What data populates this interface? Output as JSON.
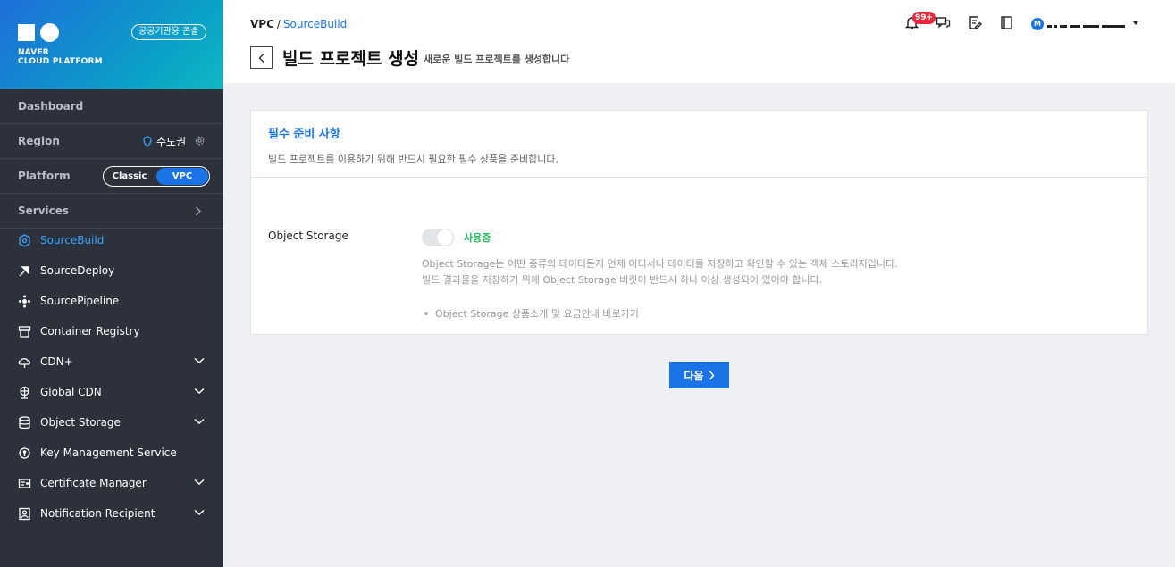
{
  "brand": {
    "line1": "NAVER",
    "line2": "CLOUD PLATFORM",
    "badge": "공공기관용 콘솔"
  },
  "sidebar": {
    "dashboard": "Dashboard",
    "region_label": "Region",
    "region_value": "수도권",
    "platform_label": "Platform",
    "platform_options": [
      "Classic",
      "VPC"
    ],
    "platform_selected": "VPC",
    "services_label": "Services",
    "items": [
      {
        "label": "SourceBuild",
        "icon": "sourcebuild-icon",
        "active": true
      },
      {
        "label": "SourceDeploy",
        "icon": "sourcedeploy-icon"
      },
      {
        "label": "SourcePipeline",
        "icon": "sourcepipeline-icon"
      },
      {
        "label": "Container Registry",
        "icon": "container-registry-icon"
      },
      {
        "label": "CDN+",
        "icon": "cdn-icon",
        "expandable": true
      },
      {
        "label": "Global CDN",
        "icon": "global-cdn-icon",
        "expandable": true
      },
      {
        "label": "Object Storage",
        "icon": "object-storage-icon",
        "expandable": true
      },
      {
        "label": "Key Management Service",
        "icon": "key-icon"
      },
      {
        "label": "Certificate Manager",
        "icon": "certificate-icon",
        "expandable": true
      },
      {
        "label": "Notification Recipient",
        "icon": "notification-recipient-icon",
        "expandable": true
      }
    ]
  },
  "header": {
    "breadcrumb_root": "VPC",
    "breadcrumb_sep": "/",
    "breadcrumb_link": "SourceBuild",
    "title": "빌드 프로젝트 생성",
    "subtitle": "새로운 빌드 프로젝트를 생성합니다",
    "notification_count": "99+",
    "avatar_initial": "M"
  },
  "card": {
    "title": "필수 준비 사항",
    "description": "빌드 프로젝트를 이용하기 위해 반드시 필요한 필수 상품을 준비합니다.",
    "row_label": "Object Storage",
    "status": "사용중",
    "desc_line1": "Object Storage는 어떤 종류의 데이터든지 언제 어디서나 데이터를 저장하고 확인할 수 있는 객체 스토리지입니다.",
    "desc_line2": "빌드 결과물을 저장하기 위해 Object Storage 버킷이 반드시 하나 이상 생성되어 있어야 합니다.",
    "link": "Object Storage 상품소개 및 요금안내 바로가기"
  },
  "actions": {
    "next_label": "다음"
  },
  "colors": {
    "accent": "#1a74e8",
    "sidebar_bg": "#2c313c",
    "status_green": "#1fb75a",
    "badge_red": "#e8283c"
  }
}
